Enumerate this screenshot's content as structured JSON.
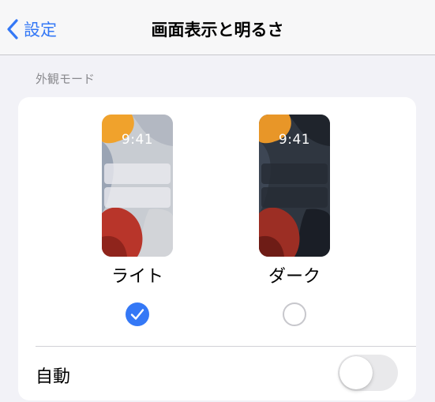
{
  "navbar": {
    "back_label": "設定",
    "title": "画面表示と明るさ"
  },
  "appearance": {
    "header": "外観モード",
    "options": [
      {
        "label": "ライト",
        "time": "9:41",
        "selected": true
      },
      {
        "label": "ダーク",
        "time": "9:41",
        "selected": false
      }
    ]
  },
  "automatic": {
    "label": "自動",
    "enabled": false
  },
  "colors": {
    "accent": "#3478f6",
    "background": "#f2f2f7",
    "toggle_off": "#e9e9eb"
  }
}
